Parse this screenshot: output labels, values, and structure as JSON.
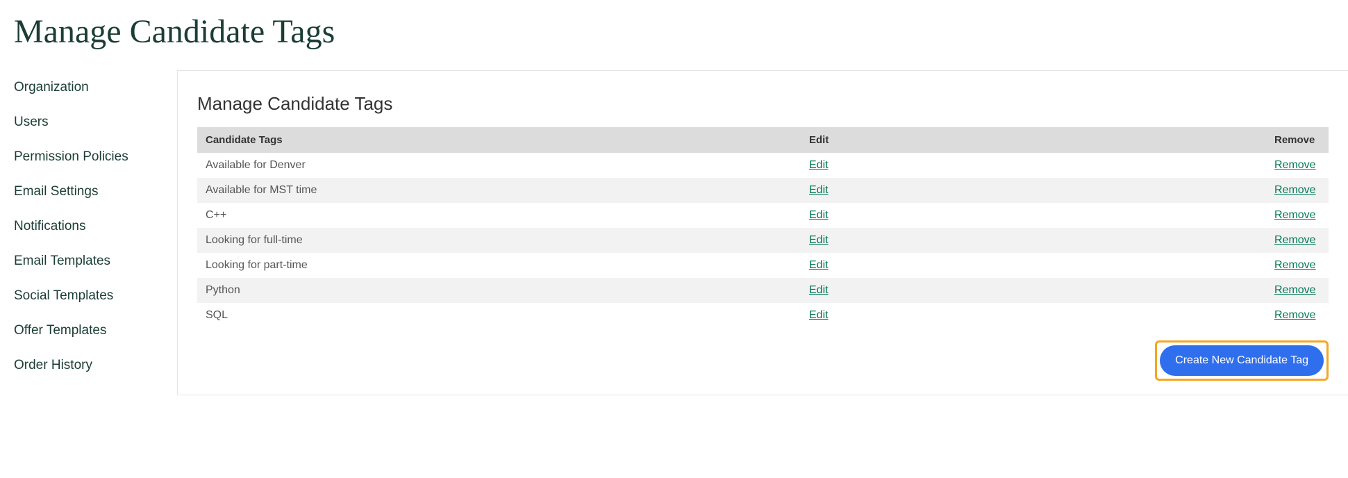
{
  "page": {
    "title": "Manage Candidate Tags"
  },
  "sidebar": {
    "items": [
      {
        "label": "Organization"
      },
      {
        "label": "Users"
      },
      {
        "label": "Permission Policies"
      },
      {
        "label": "Email Settings"
      },
      {
        "label": "Notifications"
      },
      {
        "label": "Email Templates"
      },
      {
        "label": "Social Templates"
      },
      {
        "label": "Offer Templates"
      },
      {
        "label": "Order History"
      }
    ]
  },
  "panel": {
    "title": "Manage Candidate Tags",
    "table": {
      "headers": {
        "tag": "Candidate Tags",
        "edit": "Edit",
        "remove": "Remove"
      },
      "rows": [
        {
          "tag": "Available for Denver",
          "edit": "Edit",
          "remove": "Remove"
        },
        {
          "tag": "Available for MST time",
          "edit": "Edit",
          "remove": "Remove"
        },
        {
          "tag": "C++",
          "edit": "Edit",
          "remove": "Remove"
        },
        {
          "tag": "Looking for full-time",
          "edit": "Edit",
          "remove": "Remove"
        },
        {
          "tag": "Looking for part-time",
          "edit": "Edit",
          "remove": "Remove"
        },
        {
          "tag": "Python",
          "edit": "Edit",
          "remove": "Remove"
        },
        {
          "tag": "SQL",
          "edit": "Edit",
          "remove": "Remove"
        }
      ]
    },
    "create_button": "Create New Candidate Tag"
  }
}
